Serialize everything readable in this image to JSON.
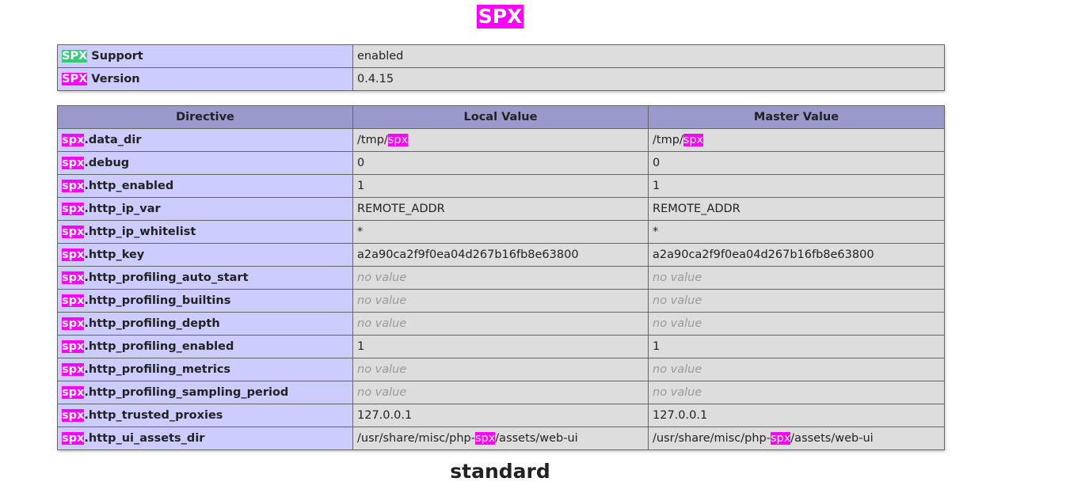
{
  "module_title": "SPX",
  "colors": {
    "highlight": "#ff00ff",
    "support_highlight": "#33cc77",
    "header_bg": "#9999cc",
    "label_bg": "#ccccff",
    "value_bg": "#dddddd"
  },
  "info": {
    "support": {
      "prefix": "SPX",
      "label": " Support",
      "value": "enabled"
    },
    "version": {
      "prefix": "SPX",
      "label": " Version",
      "value": "0.4.15"
    }
  },
  "headers": {
    "directive": "Directive",
    "local": "Local Value",
    "master": "Master Value"
  },
  "directive_prefix": "spx",
  "directives": [
    {
      "name": ".data_dir",
      "local": [
        "/tmp/",
        "spx",
        ""
      ],
      "master": [
        "/tmp/",
        "spx",
        ""
      ],
      "novalue": false
    },
    {
      "name": ".debug",
      "local": [
        "0",
        "",
        ""
      ],
      "master": [
        "0",
        "",
        ""
      ],
      "novalue": false
    },
    {
      "name": ".http_enabled",
      "local": [
        "1",
        "",
        ""
      ],
      "master": [
        "1",
        "",
        ""
      ],
      "novalue": false
    },
    {
      "name": ".http_ip_var",
      "local": [
        "REMOTE_ADDR",
        "",
        ""
      ],
      "master": [
        "REMOTE_ADDR",
        "",
        ""
      ],
      "novalue": false
    },
    {
      "name": ".http_ip_whitelist",
      "local": [
        "*",
        "",
        ""
      ],
      "master": [
        "*",
        "",
        ""
      ],
      "novalue": false
    },
    {
      "name": ".http_key",
      "local": [
        "a2a90ca2f9f0ea04d267b16fb8e63800",
        "",
        ""
      ],
      "master": [
        "a2a90ca2f9f0ea04d267b16fb8e63800",
        "",
        ""
      ],
      "novalue": false
    },
    {
      "name": ".http_profiling_auto_start",
      "local": [
        "no value",
        "",
        ""
      ],
      "master": [
        "no value",
        "",
        ""
      ],
      "novalue": true
    },
    {
      "name": ".http_profiling_builtins",
      "local": [
        "no value",
        "",
        ""
      ],
      "master": [
        "no value",
        "",
        ""
      ],
      "novalue": true
    },
    {
      "name": ".http_profiling_depth",
      "local": [
        "no value",
        "",
        ""
      ],
      "master": [
        "no value",
        "",
        ""
      ],
      "novalue": true
    },
    {
      "name": ".http_profiling_enabled",
      "local": [
        "1",
        "",
        ""
      ],
      "master": [
        "1",
        "",
        ""
      ],
      "novalue": false
    },
    {
      "name": ".http_profiling_metrics",
      "local": [
        "no value",
        "",
        ""
      ],
      "master": [
        "no value",
        "",
        ""
      ],
      "novalue": true
    },
    {
      "name": ".http_profiling_sampling_period",
      "local": [
        "no value",
        "",
        ""
      ],
      "master": [
        "no value",
        "",
        ""
      ],
      "novalue": true
    },
    {
      "name": ".http_trusted_proxies",
      "local": [
        "127.0.0.1",
        "",
        ""
      ],
      "master": [
        "127.0.0.1",
        "",
        ""
      ],
      "novalue": false
    },
    {
      "name": ".http_ui_assets_dir",
      "local": [
        "/usr/share/misc/php-",
        "spx",
        "/assets/web-ui"
      ],
      "master": [
        "/usr/share/misc/php-",
        "spx",
        "/assets/web-ui"
      ],
      "novalue": false
    }
  ],
  "next_section_title": "standard"
}
